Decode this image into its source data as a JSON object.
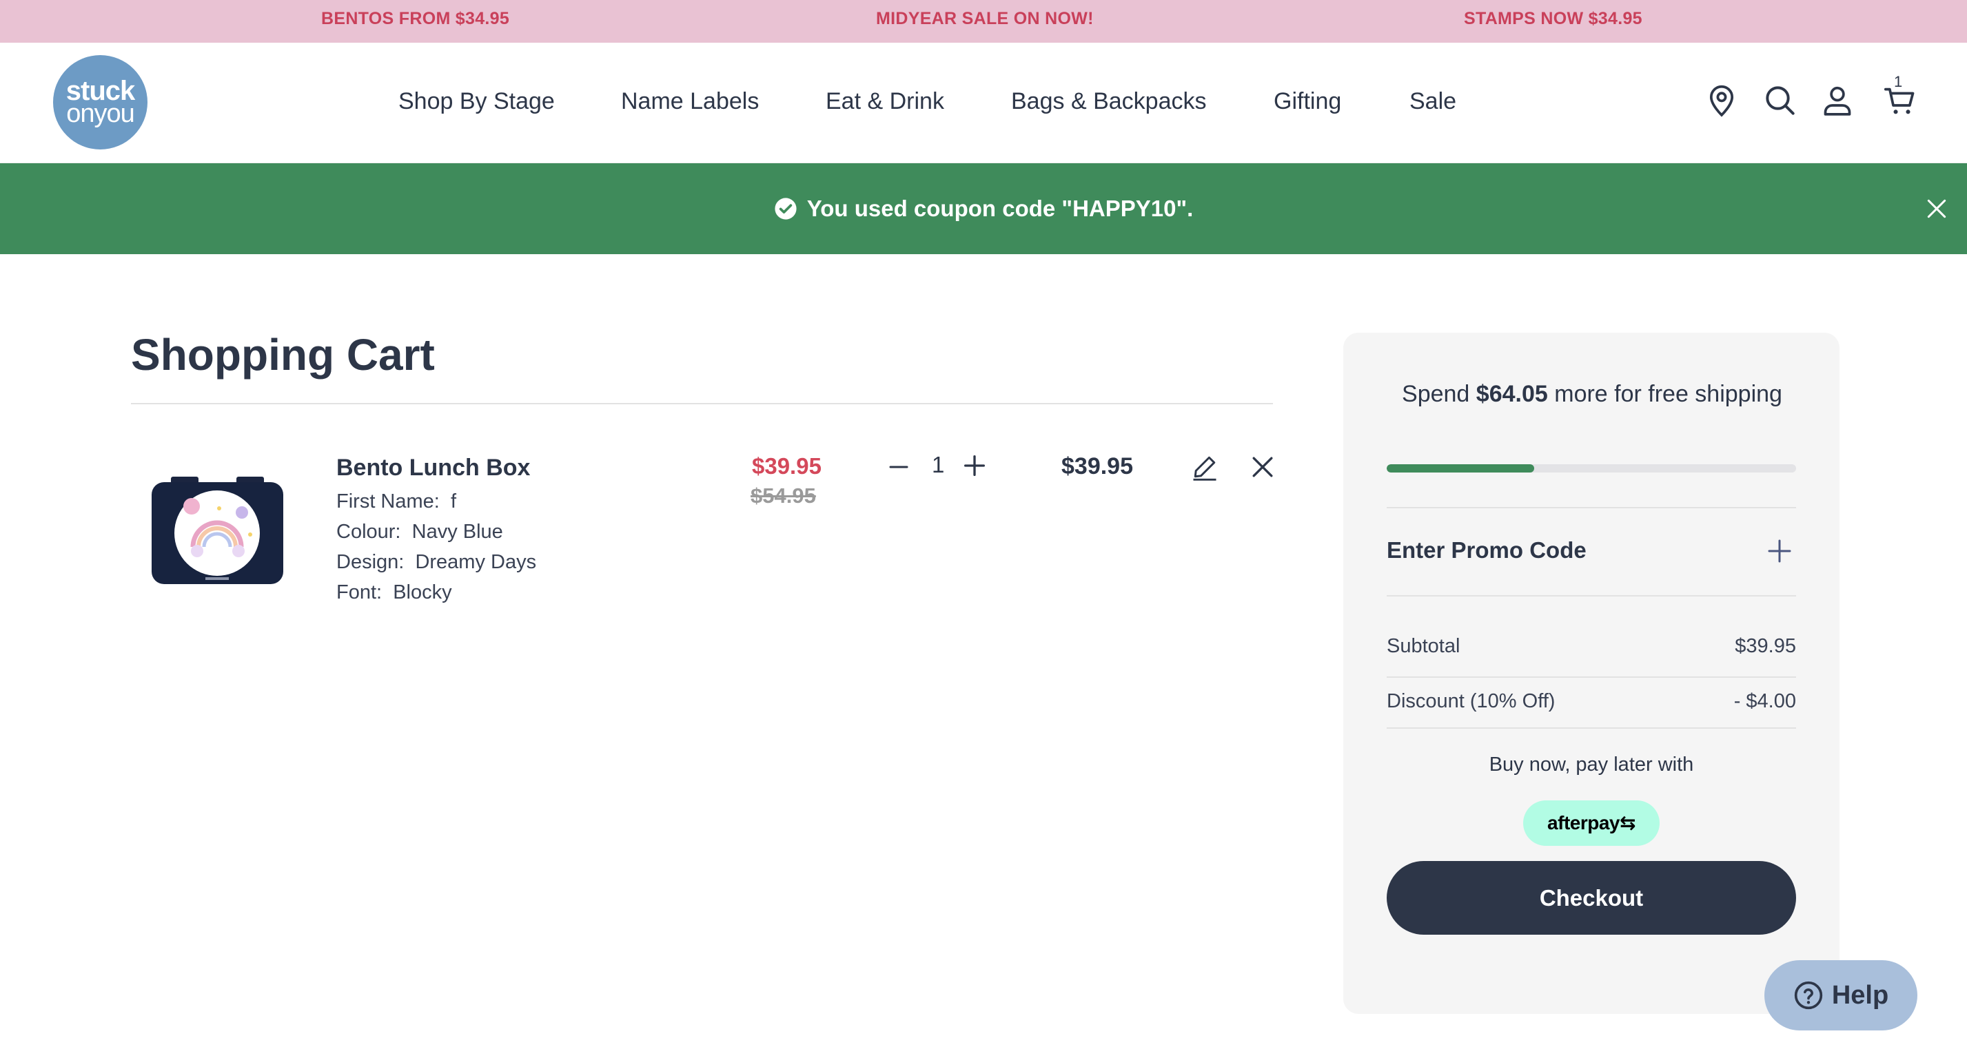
{
  "promo_bar": {
    "items": [
      "BENTOS FROM $34.95",
      "MIDYEAR SALE ON NOW!",
      "STAMPS NOW $34.95"
    ]
  },
  "header": {
    "logo": {
      "line1": "stuck",
      "line2": "onyou"
    },
    "nav": [
      "Shop By Stage",
      "Name Labels",
      "Eat & Drink",
      "Bags & Backpacks",
      "Gifting",
      "Sale"
    ],
    "icons": [
      "location-pin-icon",
      "search-icon",
      "account-icon",
      "cart-icon"
    ],
    "cart_count": "1"
  },
  "notice": {
    "message": "You used coupon code \"HAPPY10\".",
    "icons": [
      "check-circle-icon",
      "close-icon"
    ]
  },
  "cart": {
    "title": "Shopping Cart",
    "items": [
      {
        "name": "Bento Lunch Box",
        "attributes": [
          {
            "label": "First Name:",
            "value": "f"
          },
          {
            "label": "Colour:",
            "value": "Navy Blue"
          },
          {
            "label": "Design:",
            "value": "Dreamy Days"
          },
          {
            "label": "Font:",
            "value": "Blocky"
          }
        ],
        "sale_price": "$39.95",
        "original_price": "$54.95",
        "quantity": "1",
        "line_total": "$39.95"
      }
    ]
  },
  "summary": {
    "shipping_prefix": "Spend ",
    "shipping_amount": "$64.05",
    "shipping_suffix": " more for free shipping",
    "shipping_progress": 0.36,
    "promo_label": "Enter Promo Code",
    "subtotal_label": "Subtotal",
    "subtotal_value": "$39.95",
    "discount_label": "Discount (10% Off)",
    "discount_value": "- $4.00",
    "bnpl_text": "Buy now, pay later with",
    "afterpay_label": "afterpay",
    "checkout_label": "Checkout"
  },
  "help": {
    "label": "Help"
  },
  "colors": {
    "promo_bg": "#e9c2d3",
    "promo_text": "#c9405a",
    "notice_bg": "#3f8b5b",
    "primary": "#2d3648",
    "sale_price": "#d4485a",
    "afterpay_bg": "#b2fce4",
    "help_bg": "#a9bfdb"
  }
}
